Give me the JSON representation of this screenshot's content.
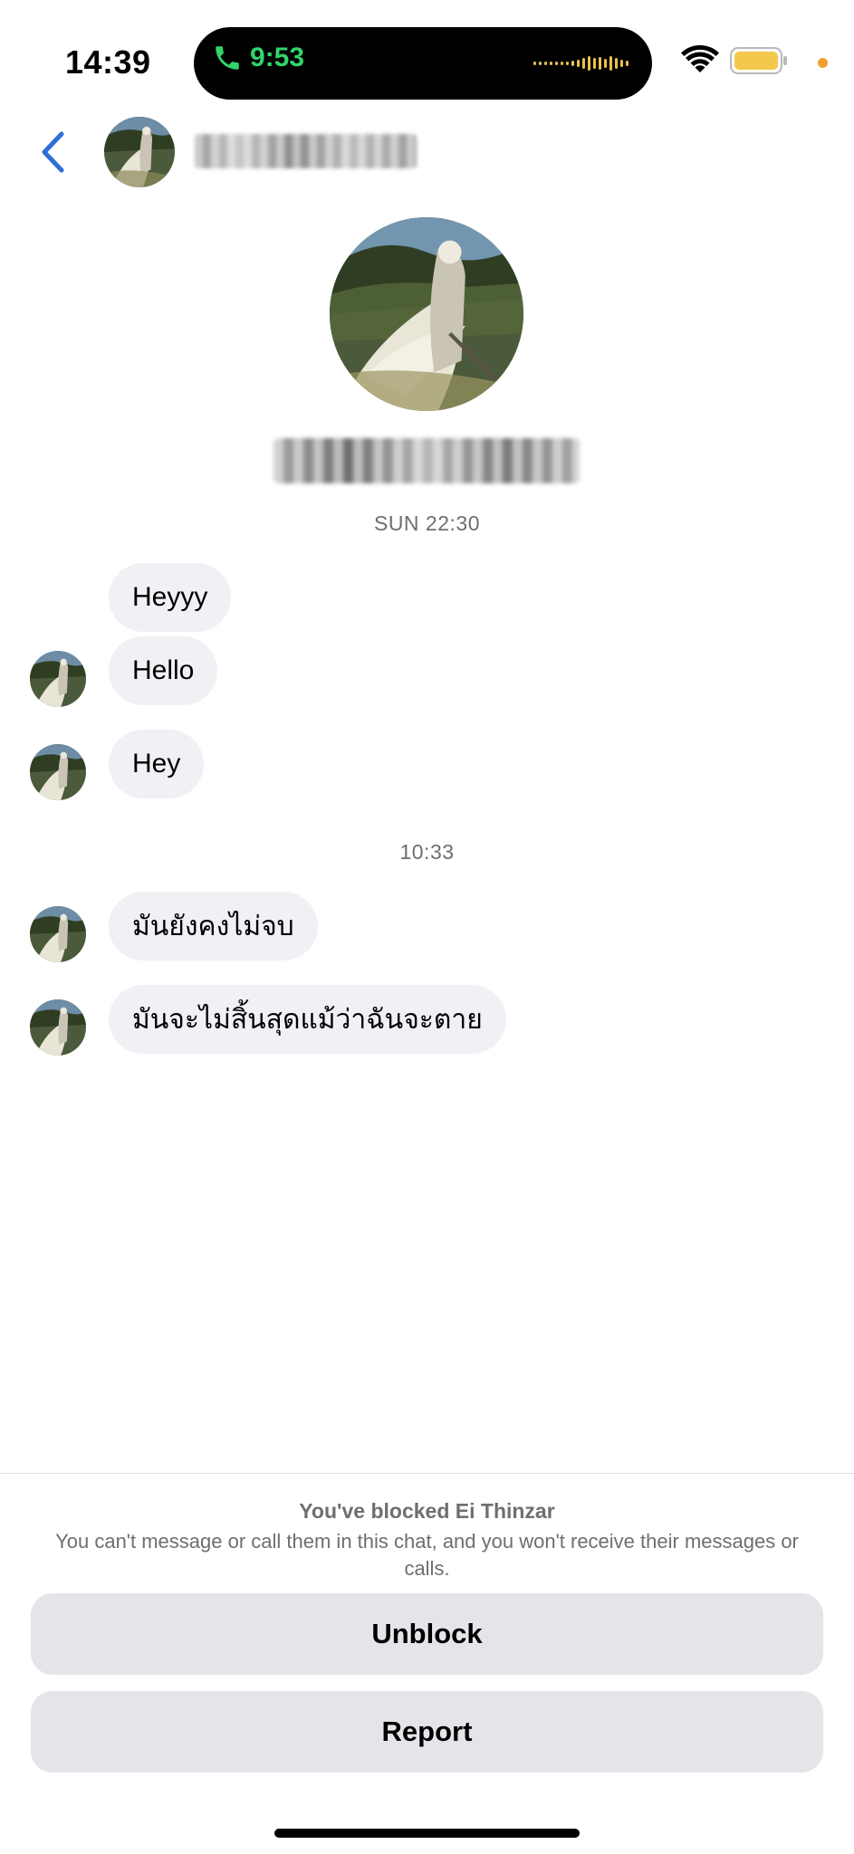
{
  "status_bar": {
    "time": "14:39",
    "call_timer": "9:53",
    "icons": [
      "phone-icon",
      "audio-wave-icon",
      "wifi-icon",
      "battery-icon",
      "privacy-dot-icon"
    ],
    "accent_call": "#33d46b",
    "battery_color": "#f2c94c"
  },
  "header": {
    "back_icon": "chevron-left-icon",
    "back_color": "#2d6fd6"
  },
  "conversation": {
    "groups": [
      {
        "timestamp": "SUN 22:30",
        "messages": [
          "Heyyy",
          "Hello",
          "Hey"
        ]
      },
      {
        "timestamp": "10:33",
        "messages": [
          "มันยังคงไม่จบ",
          "มันจะไม่สิ้นสุดแม้ว่าฉันจะตาย"
        ]
      }
    ],
    "bubble_color": "#f0f0f5"
  },
  "blocked_panel": {
    "title": "You've blocked Ei Thinzar",
    "description": "You can't message or call them in this chat, and you won't receive their messages or calls.",
    "unblock_label": "Unblock",
    "report_label": "Report"
  }
}
